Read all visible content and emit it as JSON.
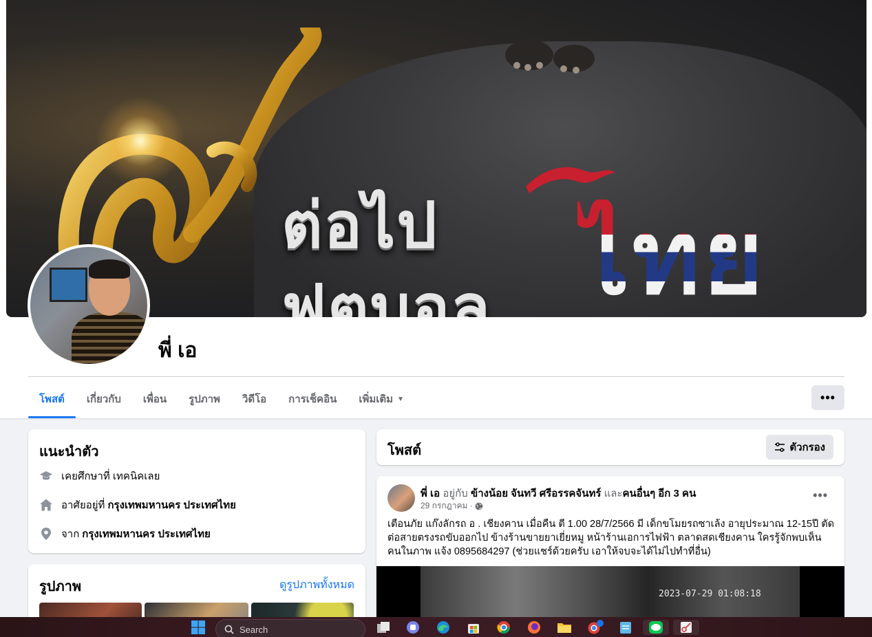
{
  "cover": {
    "line1": "ต่อไป",
    "line2": "ฟุตบอล",
    "line3": "ไทย"
  },
  "profile": {
    "name": "พี่ เอ"
  },
  "tabs": [
    {
      "label": "โพสต์",
      "active": true
    },
    {
      "label": "เกี่ยวกับ",
      "active": false
    },
    {
      "label": "เพื่อน",
      "active": false
    },
    {
      "label": "รูปภาพ",
      "active": false
    },
    {
      "label": "วิดีโอ",
      "active": false
    },
    {
      "label": "การเช็คอิน",
      "active": false
    },
    {
      "label": "เพิ่มเติม",
      "active": false,
      "dropdown": true
    }
  ],
  "more_button": "•••",
  "intro": {
    "title": "แนะนำตัว",
    "education": "เคยศึกษาที่ เทคนิคเลย",
    "lives_prefix": "อาศัยอยู่ที่",
    "lives_value": "กรุงเทพมหานคร ประเทศไทย",
    "from_prefix": "จาก",
    "from_value": "กรุงเทพมหานคร ประเทศไทย"
  },
  "photos": {
    "title": "รูปภาพ",
    "see_all": "ดูรูปภาพทั้งหมด"
  },
  "posts": {
    "title": "โพสต์",
    "filter": "ตัวกรอง"
  },
  "post": {
    "author": "พี่ เอ",
    "with_word": "อยู่กับ",
    "tagged": "ข้างน้อย จันทวี ศรีอรรคจันทร์",
    "and_word": "และ",
    "others": "คนอื่นๆ อีก 3 คน",
    "date": "29 กรกฎาคม ·",
    "dots": "•••",
    "text": "เตือนภัย แก๊งลักรถ อ . เชียงคาน เมื่อคืน ตี 1.00   28/7/2566 มี เด็กขโมยรถซาเล้ง อายุประมาณ 12-15ปี ตัดต่อสายตรงรถขับออกไป ข้างร้านขายยาเยี่ยหมู หน้าร้านเอการไฟฟ้า ตลาดสดเชียงคาน ใครรู้จักพบเห็นคนในภาพ แจ้ง 0895684297 (ช่วยแชร์ด้วยครับ เอาให้จบจะได้ไม่ไปทำที่อื่น)",
    "video_timestamp": "2023-07-29 01:08:18"
  },
  "taskbar": {
    "search_placeholder": "Search"
  },
  "colors": {
    "accent": "#1877f2",
    "secondary_text": "#65676b",
    "page_bg": "#f0f2f5"
  }
}
